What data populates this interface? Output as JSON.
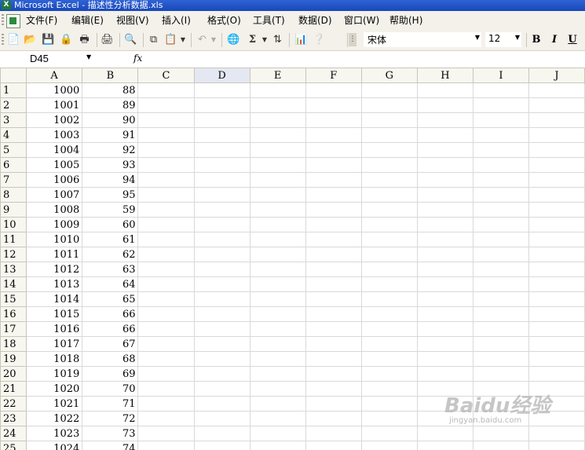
{
  "window": {
    "title": "Microsoft Excel - 描述性分析数据.xls"
  },
  "menu": [
    "文件(F)",
    "编辑(E)",
    "视图(V)",
    "插入(I)",
    "格式(O)",
    "工具(T)",
    "数据(D)",
    "窗口(W)",
    "帮助(H)"
  ],
  "toolbar": {
    "icons": [
      "new-icon",
      "open-icon",
      "save-icon",
      "permission-icon",
      "print-icon",
      "print-preview-icon",
      "research-icon",
      "copy-icon",
      "paste-icon",
      "undo-icon",
      "hyperlink-icon",
      "autosum-icon",
      "sort-ascending-icon",
      "chart-wizard-icon",
      "help-icon"
    ],
    "autosum_glyph": "Σ",
    "font_name": "宋体",
    "font_size": "12",
    "bold": "B",
    "italic": "I",
    "underline": "U"
  },
  "formula_bar": {
    "name_box": "D45",
    "fx": "fx",
    "formula": ""
  },
  "sheet": {
    "active_column": "D",
    "columns": [
      "A",
      "B",
      "C",
      "D",
      "E",
      "F",
      "G",
      "H",
      "I",
      "J"
    ],
    "rows": [
      {
        "n": "1",
        "a": "1000",
        "b": "88"
      },
      {
        "n": "2",
        "a": "1001",
        "b": "89"
      },
      {
        "n": "3",
        "a": "1002",
        "b": "90"
      },
      {
        "n": "4",
        "a": "1003",
        "b": "91"
      },
      {
        "n": "5",
        "a": "1004",
        "b": "92"
      },
      {
        "n": "6",
        "a": "1005",
        "b": "93"
      },
      {
        "n": "7",
        "a": "1006",
        "b": "94"
      },
      {
        "n": "8",
        "a": "1007",
        "b": "95"
      },
      {
        "n": "9",
        "a": "1008",
        "b": "59"
      },
      {
        "n": "10",
        "a": "1009",
        "b": "60"
      },
      {
        "n": "11",
        "a": "1010",
        "b": "61"
      },
      {
        "n": "12",
        "a": "1011",
        "b": "62"
      },
      {
        "n": "13",
        "a": "1012",
        "b": "63"
      },
      {
        "n": "14",
        "a": "1013",
        "b": "64"
      },
      {
        "n": "15",
        "a": "1014",
        "b": "65"
      },
      {
        "n": "16",
        "a": "1015",
        "b": "66"
      },
      {
        "n": "17",
        "a": "1016",
        "b": "66"
      },
      {
        "n": "18",
        "a": "1017",
        "b": "67"
      },
      {
        "n": "19",
        "a": "1018",
        "b": "68"
      },
      {
        "n": "20",
        "a": "1019",
        "b": "69"
      },
      {
        "n": "21",
        "a": "1020",
        "b": "70"
      },
      {
        "n": "22",
        "a": "1021",
        "b": "71"
      },
      {
        "n": "23",
        "a": "1022",
        "b": "72"
      },
      {
        "n": "24",
        "a": "1023",
        "b": "73"
      },
      {
        "n": "25",
        "a": "1024",
        "b": "74"
      }
    ]
  },
  "watermark": {
    "logo": "Baidu经验",
    "url": "jingyan.baidu.com"
  }
}
